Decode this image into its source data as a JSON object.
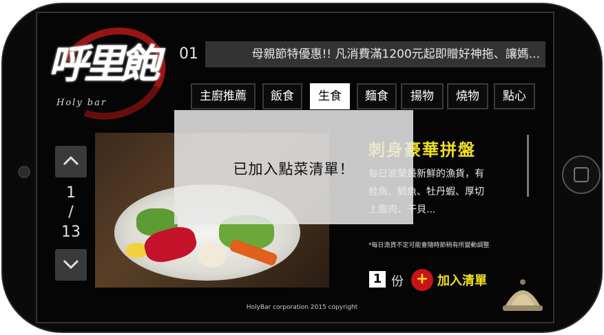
{
  "logo": {
    "main_text": "呼里飽",
    "sub_text": "Holy bar"
  },
  "ticker": {
    "number": "01",
    "text": "母親節特優惠!! 凡消費滿1200元起即贈好神拖、讓媽..."
  },
  "tabs": [
    {
      "label": "主廚推薦",
      "active": false
    },
    {
      "label": "飯食",
      "active": false
    },
    {
      "label": "生食",
      "active": true
    },
    {
      "label": "麵食",
      "active": false
    },
    {
      "label": "揚物",
      "active": false
    },
    {
      "label": "燒物",
      "active": false
    },
    {
      "label": "點心",
      "active": false
    }
  ],
  "pager": {
    "current": "1",
    "separator": "/",
    "total": "13"
  },
  "dish": {
    "title": "刺身豪華拼盤",
    "description_lines": [
      "每日波蘭最新鮮的漁貨，有",
      "鮭魚、鯛魚、牡丹蝦、厚切",
      "上腹肉、干貝..."
    ],
    "note": "*每日漁貨不定可能會隨時節稍有所變動調整"
  },
  "order": {
    "quantity": "1",
    "unit": "份",
    "add_icon_glyph": "+",
    "add_label": "加入清單"
  },
  "footer": {
    "copyright": "HolyBar corporation 2015 copyright"
  },
  "toast": {
    "message": "已加入點菜清單！"
  },
  "colors": {
    "accent_yellow": "#f0e020",
    "accent_red": "#c81414",
    "active_tab_bg": "#ffffff"
  },
  "icons": {
    "up": "chevron-up-icon",
    "down": "chevron-down-icon",
    "add": "plus-circle-icon",
    "bell": "service-bell-icon"
  }
}
